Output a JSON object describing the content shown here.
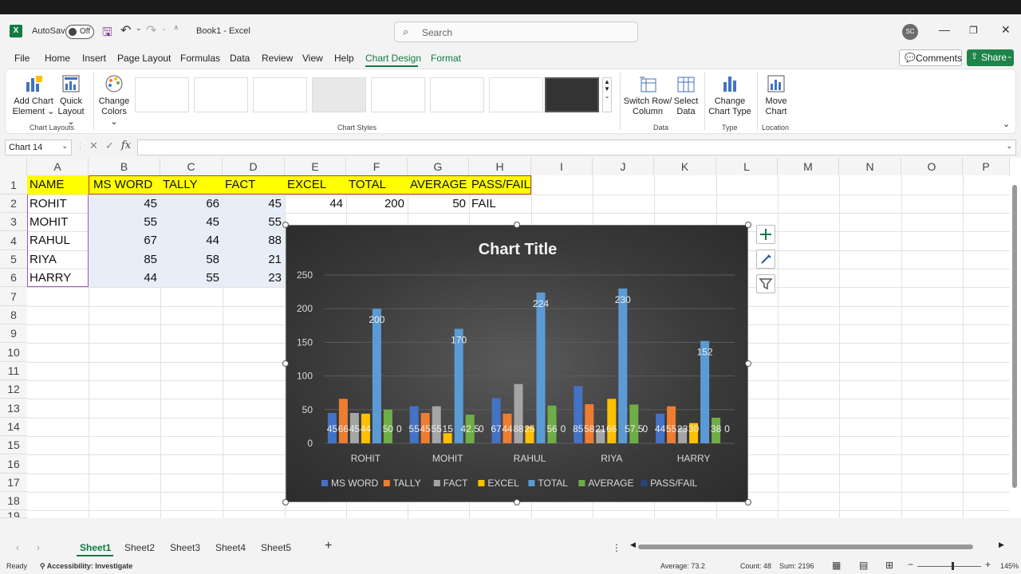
{
  "title": {
    "autosave": "AutoSave",
    "toggle": "Off",
    "book": "Book1 - Excel"
  },
  "search": {
    "placeholder": "Search"
  },
  "user": {
    "initials": "SC"
  },
  "tabs": [
    "File",
    "Home",
    "Insert",
    "Page Layout",
    "Formulas",
    "Data",
    "Review",
    "View",
    "Help",
    "Chart Design",
    "Format"
  ],
  "buttons": {
    "comments": "Comments",
    "share": "Share"
  },
  "ribbon": {
    "add_chart": [
      "Add Chart",
      "Element"
    ],
    "quick_layout": [
      "Quick",
      "Layout"
    ],
    "change_colors": [
      "Change",
      "Colors"
    ],
    "switch_row": [
      "Switch Row/",
      "Column"
    ],
    "select_data": [
      "Select",
      "Data"
    ],
    "change_type": [
      "Change",
      "Chart Type"
    ],
    "move_chart": [
      "Move",
      "Chart"
    ],
    "groups": {
      "layouts": "Chart Layouts",
      "styles": "Chart Styles",
      "data": "Data",
      "type": "Type",
      "location": "Location"
    }
  },
  "formula": {
    "namebox": "Chart 14",
    "fx": "fx"
  },
  "columns": [
    "A",
    "B",
    "C",
    "D",
    "E",
    "F",
    "G",
    "H",
    "I",
    "J",
    "K",
    "L",
    "M",
    "N",
    "O",
    "P"
  ],
  "rows": [
    "1",
    "2",
    "3",
    "4",
    "5",
    "6",
    "7",
    "8",
    "9",
    "10",
    "11",
    "12",
    "13",
    "14",
    "15",
    "16",
    "17",
    "18",
    "19"
  ],
  "table": {
    "headers": [
      "NAME",
      "MS WORD",
      "TALLY",
      "FACT",
      "EXCEL",
      "TOTAL",
      "AVERAGE",
      "PASS/FAIL"
    ],
    "data": [
      [
        "ROHIT",
        "45",
        "66",
        "45",
        "44",
        "200",
        "50",
        "FAIL"
      ],
      [
        "MOHIT",
        "55",
        "45",
        "55",
        "",
        "",
        "",
        ""
      ],
      [
        "RAHUL",
        "67",
        "44",
        "88",
        "",
        "",
        "",
        ""
      ],
      [
        "RIYA",
        "85",
        "58",
        "21",
        "",
        "",
        "",
        ""
      ],
      [
        "HARRY",
        "44",
        "55",
        "23",
        "",
        "",
        "",
        ""
      ]
    ]
  },
  "chart_data": {
    "type": "bar",
    "title": "Chart Title",
    "categories": [
      "ROHIT",
      "MOHIT",
      "RAHUL",
      "RIYA",
      "HARRY"
    ],
    "ylim": [
      0,
      250
    ],
    "yticks": [
      "0",
      "50",
      "100",
      "150",
      "200",
      "250"
    ],
    "series": [
      {
        "name": "MS WORD",
        "color": "#4472c4",
        "values": [
          45,
          55,
          67,
          85,
          44
        ]
      },
      {
        "name": "TALLY",
        "color": "#ed7d31",
        "values": [
          66,
          45,
          44,
          58,
          55
        ]
      },
      {
        "name": "FACT",
        "color": "#a5a5a5",
        "values": [
          45,
          55,
          88,
          21,
          23
        ]
      },
      {
        "name": "EXCEL",
        "color": "#ffc000",
        "values": [
          44,
          15,
          25,
          66,
          30
        ]
      },
      {
        "name": "TOTAL",
        "color": "#5b9bd5",
        "values": [
          200,
          170,
          224,
          230,
          152
        ]
      },
      {
        "name": "AVERAGE",
        "color": "#70ad47",
        "values": [
          50,
          42.5,
          56,
          57.5,
          38
        ]
      },
      {
        "name": "PASS/FAIL",
        "color": "#264478",
        "values": [
          0,
          0,
          0,
          0,
          0
        ]
      }
    ],
    "grid": true,
    "legend": "bottom"
  },
  "sheets": [
    "Sheet1",
    "Sheet2",
    "Sheet3",
    "Sheet4",
    "Sheet5"
  ],
  "status": {
    "ready": "Ready",
    "accessibility": "Accessibility: Investigate",
    "average": "Average: 73.2",
    "count": "Count: 48",
    "sum": "Sum: 2196",
    "zoom": "145%"
  }
}
